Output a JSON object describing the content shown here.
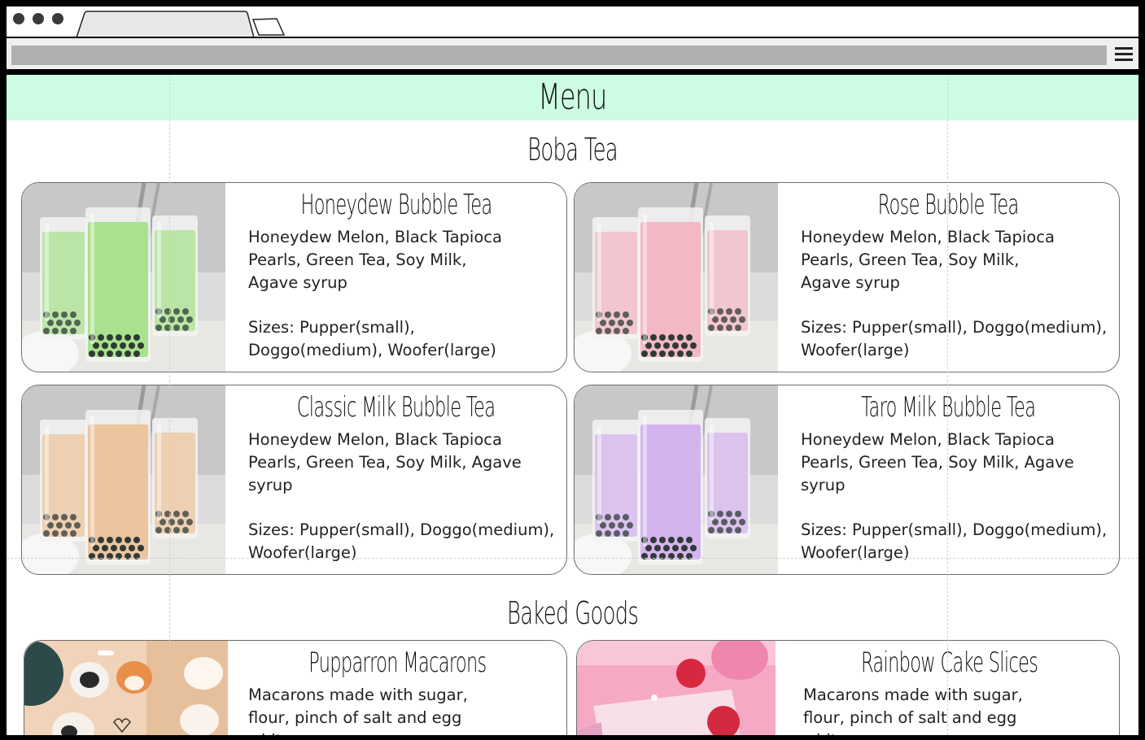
{
  "page": {
    "header": {
      "title": "Menu",
      "bg_color": "#ccfde3"
    },
    "sections": [
      {
        "title": "Boba Tea",
        "items": [
          {
            "name": "Honeydew Bubble Tea",
            "description": "Honeydew Melon, Black Tapioca Pearls, Green Tea, Soy Milk, Agave syrup",
            "sizes": "Sizes:  Pupper(small), Doggo(medium), Woofer(large)",
            "drink_color": "#a9e28e"
          },
          {
            "name": "Rose Bubble Tea",
            "description": "Honeydew Melon, Black Tapioca Pearls, Green Tea, Soy Milk, Agave syrup",
            "sizes": "Sizes: Pupper(small), Doggo(medium), Woofer(large)",
            "drink_color": "#f2b8c4"
          },
          {
            "name": "Classic Milk Bubble Tea",
            "description": "Honeydew Melon, Black Tapioca Pearls, Green Tea, Soy Milk, Agave syrup",
            "sizes": "Sizes:  Pupper(small), Doggo(medium), Woofer(large)",
            "drink_color": "#ecc49e"
          },
          {
            "name": "Taro Milk Bubble Tea",
            "description": "Honeydew Melon, Black Tapioca Pearls, Green Tea, Soy Milk, Agave syrup",
            "sizes": "Sizes: Pupper(small), Doggo(medium), Woofer(large)",
            "drink_color": "#d4b4ee"
          }
        ]
      },
      {
        "title": "Baked Goods",
        "items": [
          {
            "name": "Pupparron Macarons",
            "description": "Macarons made with sugar, flour, pinch of salt and egg whites"
          },
          {
            "name": "Rainbow Cake Slices",
            "description": "Macarons made with sugar, flour, pinch of salt and egg whites"
          }
        ]
      }
    ]
  }
}
